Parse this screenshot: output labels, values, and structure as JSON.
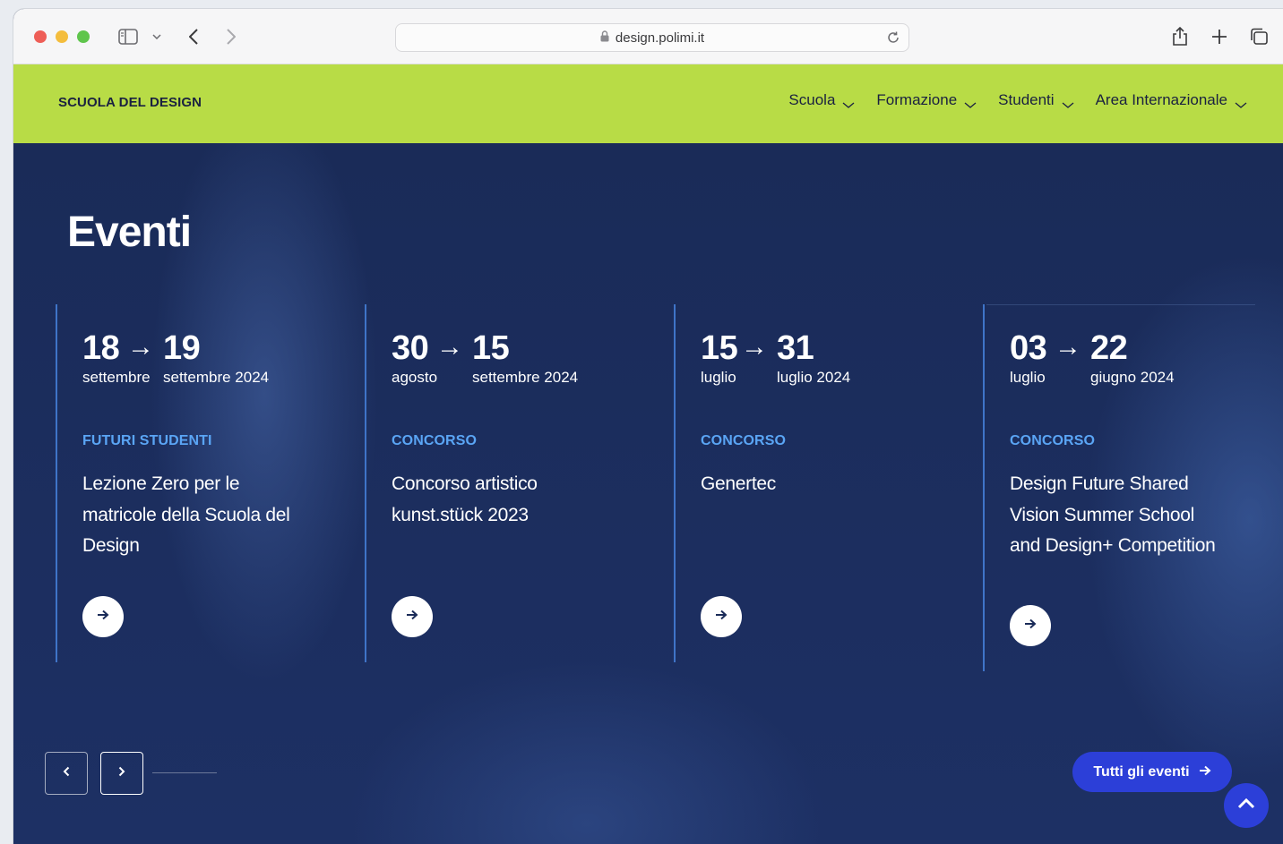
{
  "browser": {
    "url": "design.polimi.it",
    "icons": [
      "sidebar-icon",
      "chevron-down-icon",
      "back-icon",
      "forward-icon",
      "lock-icon",
      "reload-icon",
      "share-icon",
      "plus-icon",
      "tabs-icon"
    ]
  },
  "header": {
    "brand": "SCUOLA DEL DESIGN",
    "background": "#b8dc46",
    "nav": [
      {
        "label": "Scuola"
      },
      {
        "label": "Formazione"
      },
      {
        "label": "Studenti"
      },
      {
        "label": "Area Internazionale"
      }
    ]
  },
  "events": {
    "title": "Eventi",
    "items": [
      {
        "start_day": "18",
        "start_month": "settembre",
        "end_day": "19",
        "end_month": "settembre 2024",
        "category": "FUTURI STUDENTI",
        "title": "Lezione Zero per le matricole della Scuola del Design"
      },
      {
        "start_day": "30",
        "start_month": "agosto",
        "end_day": "15",
        "end_month": "settembre 2024",
        "category": "CONCORSO",
        "title": "Concorso artistico kunst.stück 2023"
      },
      {
        "start_day": "15",
        "start_month": "luglio",
        "end_day": "31",
        "end_month": "luglio 2024",
        "category": "CONCORSO",
        "title": "Genertec"
      },
      {
        "start_day": "03",
        "start_month": "luglio",
        "end_day": "22",
        "end_month": "giugno 2024",
        "category": "CONCORSO",
        "title": "Design Future Shared Vision Summer School and Design+ Competition"
      }
    ],
    "arrow": "→",
    "all_events_label": "Tutti gli eventi",
    "accent": "#2c3fd8",
    "category_color": "#5aa5f5"
  }
}
